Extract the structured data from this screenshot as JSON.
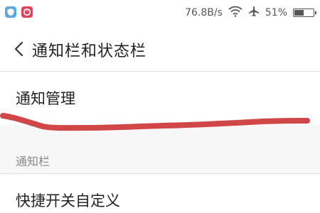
{
  "status_bar": {
    "left_icons": [
      "shield-app-icon",
      "red-app-icon"
    ],
    "network_speed": "76.8B/s",
    "icons": [
      "wifi-icon",
      "airplane-icon",
      "battery-icon"
    ],
    "battery_text": "51%",
    "battery_level": 0.51
  },
  "header": {
    "back_icon": "chevron-left-icon",
    "title": "通知栏和状态栏"
  },
  "main": {
    "notification_manage_label": "通知管理",
    "section_header": "通知栏",
    "quick_switch_label": "快捷开关自定义"
  },
  "colors": {
    "scribble": "#cc3333",
    "section_bg": "#f7f7f7",
    "divider": "#e0e0e0"
  }
}
